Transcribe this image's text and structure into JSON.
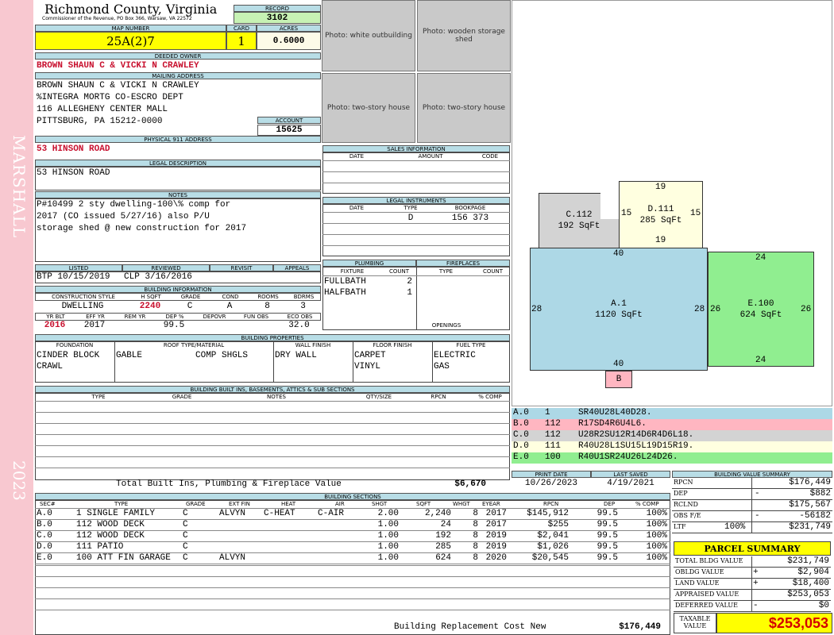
{
  "sidebar": {
    "district": "MARSHALL",
    "year": "2023"
  },
  "header": {
    "county": "Richmond County, Virginia",
    "commissioner": "Commissioner of the Revenue, PO Box 366, Warsaw, VA 22572",
    "record_label": "RECORD",
    "record": "3102",
    "map_number_label": "MAP NUMBER",
    "map_number": "25A(2)7",
    "card_label": "CARD",
    "card": "1",
    "acres_label": "ACRES",
    "acres": "0.6000"
  },
  "photos": {
    "p1": "Photo: white outbuilding",
    "p2": "Photo: wooden storage shed",
    "p3": "Photo: two-story house",
    "p4": "Photo: two-story house"
  },
  "owner": {
    "deeded_label": "DEEDED OWNER",
    "deeded": "BROWN SHAUN C & VICKI N CRAWLEY",
    "mailing_label": "MAILING ADDRESS",
    "mailing": [
      "BROWN SHAUN C & VICKI N CRAWLEY",
      "%INTEGRA MORTG CO-ESCRO DEPT",
      "116 ALLEGHENY CENTER MALL",
      "PITTSBURG, PA 15212-0000"
    ],
    "account_label": "ACCOUNT",
    "account": "15625"
  },
  "physical": {
    "label": "PHYSICAL 911 ADDRESS",
    "value": "53 HINSON ROAD"
  },
  "legal": {
    "label": "LEGAL DESCRIPTION",
    "value": "53 HINSON ROAD"
  },
  "notes": {
    "label": "NOTES",
    "lines": [
      "P#10499 2 sty dwelling-100\\% comp for",
      "2017 (CO issued 5/27/16) also P/U",
      "storage shed @ new construction for 2017"
    ]
  },
  "sales": {
    "label": "SALES INFORMATION",
    "cols": [
      "DATE",
      "AMOUNT",
      "CODE"
    ]
  },
  "legal_instruments": {
    "label": "LEGAL INSTRUMENTS",
    "cols": [
      "DATE",
      "TYPE",
      "BOOKPAGE"
    ],
    "type": "D",
    "bookpage": "156 373"
  },
  "listing": {
    "listed_label": "LISTED",
    "reviewed_label": "REVIEWED",
    "revisit_label": "REVISIT",
    "appeals_label": "APPEALS",
    "listed": "BTP 10/15/2019",
    "reviewed": "CLP  3/16/2016"
  },
  "building_info": {
    "label": "BUILDING INFORMATION",
    "cols1": [
      "CONSTRUCTION STYLE",
      "H SQFT",
      "GRADE",
      "COND",
      "ROOMS",
      "BDRMS"
    ],
    "vals1": [
      "DWELLING",
      "2240",
      "C",
      "A",
      "8",
      "3"
    ],
    "cols2": [
      "YR BLT",
      "EFF YR",
      "REM YR",
      "DEP %",
      "DEPOVR",
      "FUN OBS",
      "ECO OBS"
    ],
    "vals2": [
      "2016",
      "2017",
      "",
      "99.5",
      "",
      "",
      "32.0"
    ]
  },
  "plumbing": {
    "label": "PLUMBING",
    "cols": [
      "FIXTURE",
      "COUNT"
    ],
    "rows": [
      [
        "FULLBATH",
        "2"
      ],
      [
        "HALFBATH",
        "1"
      ]
    ]
  },
  "fireplaces": {
    "label": "FIREPLACES",
    "cols": [
      "TYPE",
      "COUNT"
    ],
    "openings_label": "OPENINGS"
  },
  "building_props": {
    "label": "BUILDING PROPERTIES",
    "cols": [
      "FOUNDATION",
      "ROOF TYPE/MATERIAL",
      "WALL FINISH",
      "FLOOR FINISH",
      "FUEL TYPE"
    ],
    "foundation": [
      "CINDER BLOCK",
      "CRAWL"
    ],
    "roof_type": "GABLE",
    "roof_material": "COMP SHGLS",
    "wall": "DRY WALL",
    "floor": [
      "CARPET",
      "VINYL"
    ],
    "fuel": [
      "ELECTRIC",
      "GAS"
    ]
  },
  "builtins": {
    "label": "BUILDING BUILT INS, BASEMENTS, ATTICS & SUB SECTIONS",
    "cols": [
      "TYPE",
      "GRADE",
      "NOTES",
      "QTY/SIZE",
      "RPCN",
      "% COMP"
    ],
    "total_label": "Total Built Ins, Plumbing & Fireplace Value",
    "total": "$6,670"
  },
  "sketch": {
    "areas": [
      {
        "code": "C.112",
        "sqft": "192 SqFt"
      },
      {
        "code": "D.111",
        "sqft": "285 SqFt"
      },
      {
        "code": "A.1",
        "sqft": "1120 SqFt"
      },
      {
        "code": "E.100",
        "sqft": "624 SqFt"
      },
      {
        "code": "B",
        "sqft": ""
      }
    ],
    "dims": {
      "d_top": "19",
      "d_left": "15",
      "d_right": "15",
      "d_bottom": "19",
      "a_top": "40",
      "a_left": "28",
      "a_right": "28",
      "a_bottom": "40",
      "e_top": "24",
      "e_left": "26",
      "e_right": "26",
      "e_bottom": "24"
    }
  },
  "legend": [
    {
      "sec": "A.0",
      "code": "1",
      "path": "SR40U28L40D28.",
      "color": "#add8e6"
    },
    {
      "sec": "B.0",
      "code": "112",
      "path": "R17SD4R6U4L6.",
      "color": "#ffb6c1"
    },
    {
      "sec": "C.0",
      "code": "112",
      "path": "U28R2SU12R14D6R4D6L18.",
      "color": "#d3d3d3"
    },
    {
      "sec": "D.0",
      "code": "111",
      "path": "R40U28L1SU15L19D15R19.",
      "color": "#ffffe0"
    },
    {
      "sec": "E.0",
      "code": "100",
      "path": "R40U1SR24U26L24D26.",
      "color": "#90ee90"
    }
  ],
  "dates": {
    "print_label": "PRINT DATE",
    "print": "10/26/2023",
    "saved_label": "LAST SAVED",
    "saved": "4/19/2021"
  },
  "value_summary": {
    "label": "BUILDING VALUE SUMMARY",
    "rows": [
      {
        "label": "RPCN",
        "sign": "",
        "value": "$176,449"
      },
      {
        "label": "DEP",
        "sign": "-",
        "value": "$882"
      },
      {
        "label": "RCLND",
        "sign": "",
        "value": "$175,567"
      },
      {
        "label": "OBS F/E",
        "sign": "-",
        "value": "-56182"
      },
      {
        "label": "LTF",
        "pct": "100%",
        "sign": "",
        "value": "$231,749"
      }
    ]
  },
  "sections": {
    "label": "BUILDING SECTIONS",
    "cols": [
      "SEC#",
      "TYPE",
      "GRADE",
      "EXT FIN",
      "HEAT",
      "AIR",
      "SHGT",
      "SQFT",
      "WHGT",
      "EYEAR",
      "RPCN",
      "DEP",
      "% COMP"
    ],
    "rows": [
      [
        "A.0",
        "1 SINGLE FAMILY",
        "C",
        "ALVYN",
        "C-HEAT",
        "C-AIR",
        "2.00",
        "2,240",
        "8",
        "2017",
        "$145,912",
        "99.5",
        "100%"
      ],
      [
        "B.0",
        "112 WOOD DECK",
        "C",
        "",
        "",
        "",
        "1.00",
        "24",
        "8",
        "2017",
        "$255",
        "99.5",
        "100%"
      ],
      [
        "C.0",
        "112 WOOD DECK",
        "C",
        "",
        "",
        "",
        "1.00",
        "192",
        "8",
        "2019",
        "$2,041",
        "99.5",
        "100%"
      ],
      [
        "D.0",
        "111 PATIO",
        "C",
        "",
        "",
        "",
        "1.00",
        "285",
        "8",
        "2019",
        "$1,026",
        "99.5",
        "100%"
      ],
      [
        "E.0",
        "100 ATT FIN GARAGE",
        "C",
        "ALVYN",
        "",
        "",
        "1.00",
        "624",
        "8",
        "2020",
        "$20,545",
        "99.5",
        "100%"
      ]
    ],
    "total_label": "Building Replacement Cost New",
    "total": "$176,449"
  },
  "parcel": {
    "title": "PARCEL SUMMARY",
    "rows": [
      {
        "label": "TOTAL BLDG VALUE",
        "sign": "",
        "value": "$231,749"
      },
      {
        "label": "OBLDG VALUE",
        "sign": "+",
        "value": "$2,904"
      },
      {
        "label": "LAND VALUE",
        "sign": "+",
        "value": "$18,400"
      },
      {
        "label": "APPRAISED VALUE",
        "sign": "",
        "value": "$253,053"
      },
      {
        "label": "DEFERRED VALUE",
        "sign": "-",
        "value": "$0"
      }
    ],
    "taxable_label": "TAXABLE VALUE",
    "taxable": "$253,053"
  }
}
